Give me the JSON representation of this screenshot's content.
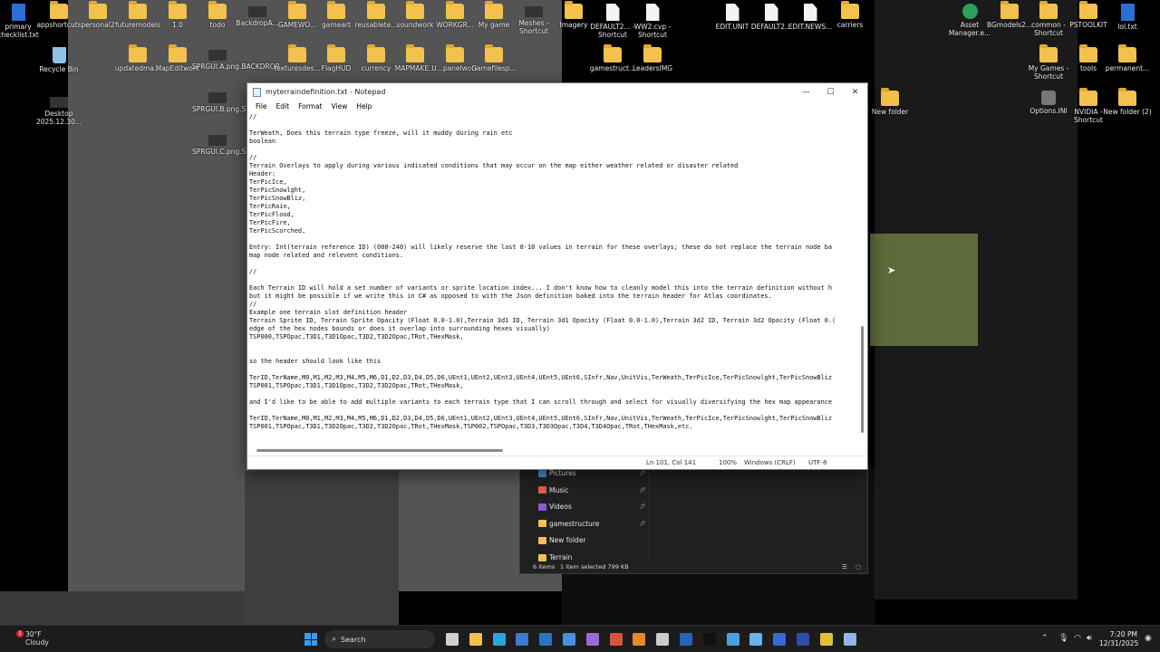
{
  "desktop": {
    "icons": [
      {
        "label": "primary\nchecklist.txt",
        "icon": "text-file-icon"
      },
      {
        "label": "appshortcuts",
        "icon": "folder-icon"
      },
      {
        "label": "personal2",
        "icon": "folder-icon"
      },
      {
        "label": "futuremodels",
        "icon": "folder-icon"
      },
      {
        "label": "1.0",
        "icon": "folder-icon"
      },
      {
        "label": "todo",
        "icon": "folder-icon"
      },
      {
        "label": "BackdropA...",
        "icon": "image-file-icon"
      },
      {
        "label": "GAMEWO...",
        "icon": "folder-icon"
      },
      {
        "label": "gameart",
        "icon": "folder-icon"
      },
      {
        "label": "reusablete...",
        "icon": "folder-icon"
      },
      {
        "label": "soundwork",
        "icon": "folder-icon"
      },
      {
        "label": "WORKGR...",
        "icon": "folder-icon"
      },
      {
        "label": "My game",
        "icon": "folder-icon"
      },
      {
        "label": "Meshes - Shortcut",
        "icon": "shortcut-icon"
      },
      {
        "label": "Imagery",
        "icon": "folder-icon"
      },
      {
        "label": "DEFAULT2... - Shortcut",
        "icon": "file-icon"
      },
      {
        "label": "WW2.cvp - Shortcut",
        "icon": "file-icon"
      },
      {
        "label": "EDIT.UNIT",
        "icon": "file-icon"
      },
      {
        "label": "DEFAULT2...",
        "icon": "file-icon"
      },
      {
        "label": "EDIT.NEWS...",
        "icon": "file-icon"
      },
      {
        "label": "carriers",
        "icon": "folder-icon"
      },
      {
        "label": "Asset Manager.e...",
        "icon": "app-icon"
      },
      {
        "label": "BGmodels2...",
        "icon": "folder-icon"
      },
      {
        "label": "common - Shortcut",
        "icon": "folder-icon"
      },
      {
        "label": "PSTOOLKIT",
        "icon": "folder-icon"
      },
      {
        "label": "lol.txt",
        "icon": "text-file-icon"
      },
      {
        "label": "Recycle Bin",
        "icon": "recycle-bin-icon"
      },
      {
        "label": "updatedma...",
        "icon": "folder-icon"
      },
      {
        "label": "MapEditwork",
        "icon": "folder-icon"
      },
      {
        "label": "SPRGUI.A.png.BACKDROP...",
        "icon": "image-file-icon"
      },
      {
        "label": "texturesdes...",
        "icon": "folder-icon"
      },
      {
        "label": "FlagHUD",
        "icon": "folder-icon"
      },
      {
        "label": "currency",
        "icon": "folder-icon"
      },
      {
        "label": "MAPMAKE...",
        "icon": "folder-icon"
      },
      {
        "label": "U...panelwork",
        "icon": "folder-icon"
      },
      {
        "label": "Gamefilesp...",
        "icon": "folder-icon"
      },
      {
        "label": "gamestruct...",
        "icon": "folder-icon"
      },
      {
        "label": "LeadersIMG",
        "icon": "folder-icon"
      },
      {
        "label": "My Games - Shortcut",
        "icon": "folder-icon"
      },
      {
        "label": "tools",
        "icon": "folder-icon"
      },
      {
        "label": "permanent...",
        "icon": "folder-icon"
      },
      {
        "label": "Desktop 2025.12.30...",
        "icon": "image-file-icon"
      },
      {
        "label": "SPRGUI.B.png.S...",
        "icon": "image-file-icon"
      },
      {
        "label": "SPRGUI.C.png.S...",
        "icon": "image-file-icon"
      },
      {
        "label": "New folder",
        "icon": "folder-icon"
      },
      {
        "label": "Options.INI",
        "icon": "settings-file-icon"
      },
      {
        "label": "NVIDIA - Shortcut",
        "icon": "folder-icon"
      },
      {
        "label": "New folder (2)",
        "icon": "folder-icon"
      }
    ]
  },
  "notepad": {
    "title": "myterraindefinition.txt - Notepad",
    "menu": [
      "File",
      "Edit",
      "Format",
      "View",
      "Help"
    ],
    "window_buttons": {
      "minimize": "—",
      "maximize": "☐",
      "close": "✕"
    },
    "lines": [
      "//",
      "",
      "TerWeath, Does this terrain type freeze, will it muddy during rain etc",
      "boolean",
      "",
      "//",
      "Terrain Overlays to apply during various indicated conditions that may occur on the map either weather related or disaster related",
      "Header:",
      "TerPicIce,",
      "TerPicSnowlght,",
      "TerPicSnowBliz,",
      "TerPicRain,",
      "TerPicFlood,",
      "TerPicFire,",
      "TerPicScorched,",
      "",
      "Entry: Int(terrain reference ID) (000-240) will likely reserve the last 8-10 values in terrain for these overlays; these do not replace the terrain node ba",
      "map node related and relevent conditions.",
      "",
      "//",
      "",
      "Each Terrain ID will hold a set number of variants or sprite location index... I don't know how to cleanly model this into the terrain definition without h",
      "but it might be possible if we write this in C# as opposed to with the Json definition baked into the terrain header for Atlas coordinates.",
      "//",
      "Example one terrain slot definition header",
      "Terrain Sprite ID, Terrain Sprite Opacity (Float 0.0-1.0),Terrain 3d1 ID, Terrain 3d1 Opacity (Float 0.0-1.0),Terrain 3d2 ID, Terrain 3d2 Opacity (Float 0.(",
      "edge of the hex nodes bounds or does it overlap into surrounding hexes visually)",
      "TSP000,TSPOpac,T3D1,T3D1Opac,T3D2,T3D2Opac,TRot,THexMask,",
      "",
      "",
      "so the header should look like this",
      "",
      "TerID,TerName,M0,M1,M2,M3,M4,M5,M6,D1,D2,D3,D4,D5,D6,UEnt1,UEnt2,UEnt3,UEnt4,UEnt5,UEnt6,SInfr,Nav,UnitVis,TerWeath,TerPicIce,TerPicSnowlght,TerPicSnowBliz",
      "TSP001,TSPOpac,T3D1,T3D1Opac,T3D2,T3D2Opac,TRot,THexMask,",
      "",
      "and I'd like to be able to add multiple variants to each terrain type that I can scroll through and select for visually diversifying the hex map appearance",
      "",
      "TerID,TerName,M0,M1,M2,M3,M4,M5,M6,D1,D2,D3,D4,D5,D6,UEnt1,UEnt2,UEnt3,UEnt4,UEnt5,UEnt6,SInfr,Nav,UnitVis,TerWeath,TerPicIce,TerPicSnowlght,TerPicSnowBliz",
      "TSP001,TSPOpac,T3D1,T3D2Opac,T3D2,T3D2Opac,TRot,THexMask,TSP002,TSPOpac,T3D3,T3D3Opac,T3D4,T3D4Opac,TRot,THexMask,etc."
    ],
    "status": {
      "position": "Ln 101, Col 141",
      "zoom": "100%",
      "line_ending": "Windows (CRLF)",
      "encoding": "UTF-8"
    }
  },
  "explorer": {
    "nav_items": [
      {
        "label": "Pictures",
        "icon": "pictures-icon",
        "pinned": true,
        "color": "#4a8fd8"
      },
      {
        "label": "Music",
        "icon": "music-icon",
        "pinned": true,
        "color": "#e05a4a"
      },
      {
        "label": "Videos",
        "icon": "videos-icon",
        "pinned": true,
        "color": "#8a5ad8"
      },
      {
        "label": "gamestructure",
        "icon": "folder-icon",
        "pinned": true,
        "color": "#f2c14e"
      },
      {
        "label": "New folder",
        "icon": "folder-icon",
        "pinned": false,
        "color": "#f2c14e"
      },
      {
        "label": "Terrain",
        "icon": "folder-icon",
        "pinned": false,
        "color": "#f2c14e"
      }
    ],
    "status": {
      "items": "6 items",
      "selected": "1 item selected  799 KB"
    }
  },
  "taskbar": {
    "weather": {
      "badge": "1",
      "temp": "30°F",
      "condition": "Cloudy"
    },
    "search_label": "Search",
    "apps": [
      {
        "name": "task-view-icon",
        "color": "#cfcfcf"
      },
      {
        "name": "file-explorer-icon",
        "color": "#f2c14e"
      },
      {
        "name": "edge-icon",
        "color": "#2aa5d8"
      },
      {
        "name": "store-icon",
        "color": "#3b7bd1"
      },
      {
        "name": "outlook-icon",
        "color": "#2a73c9"
      },
      {
        "name": "notes-icon",
        "color": "#4c8fe0"
      },
      {
        "name": "visual-studio-icon",
        "color": "#9a6ad8"
      },
      {
        "name": "game-icon",
        "color": "#d8553a"
      },
      {
        "name": "blender-icon",
        "color": "#e58a2a"
      },
      {
        "name": "unity-icon",
        "color": "#cccccc"
      },
      {
        "name": "word-icon",
        "color": "#2b5fb8"
      },
      {
        "name": "terminal-icon",
        "color": "#111111"
      },
      {
        "name": "snip-icon",
        "color": "#4aa3e0"
      },
      {
        "name": "paint-icon",
        "color": "#6fb0e8"
      },
      {
        "name": "headset-icon",
        "color": "#3a6ad0"
      },
      {
        "name": "photoshop-icon",
        "color": "#2a4fa8"
      },
      {
        "name": "chrome-icon",
        "color": "#e0c03a"
      },
      {
        "name": "notepad-icon",
        "color": "#8fb8e8"
      }
    ],
    "clock": {
      "time": "7:20 PM",
      "date": "12/31/2025"
    }
  }
}
